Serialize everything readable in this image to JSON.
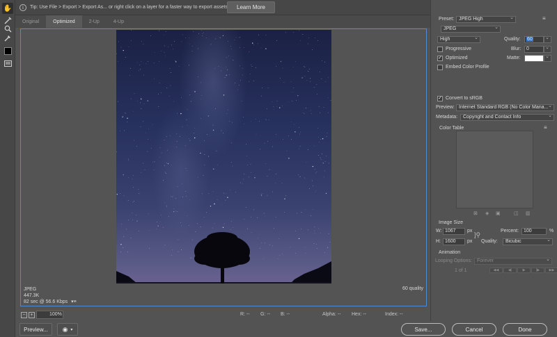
{
  "tip": {
    "icon": "info-circle-icon",
    "text": "Tip: Use File > Export > Export As...  or right click on a layer for a faster way to export assets",
    "learn_more": "Learn More"
  },
  "tabs": [
    {
      "label": "Original",
      "active": false
    },
    {
      "label": "Optimized",
      "active": true
    },
    {
      "label": "2-Up",
      "active": false
    },
    {
      "label": "4-Up",
      "active": false
    }
  ],
  "preview_info": {
    "format": "JPEG",
    "size": "447.3K",
    "time": "82 sec @ 56.6 Kbps",
    "quality": "60 quality"
  },
  "status": {
    "zoom_out": "−",
    "zoom_in": "+",
    "zoom": "100%",
    "r": "R: --",
    "g": "G: --",
    "b": "B: --",
    "alpha": "Alpha: --",
    "hex": "Hex: --",
    "index": "Index: --"
  },
  "buttons": {
    "preview": "Preview...",
    "save": "Save...",
    "cancel": "Cancel",
    "done": "Done"
  },
  "settings": {
    "preset_label": "Preset:",
    "preset": "JPEG High",
    "format": "JPEG",
    "compression": "High",
    "quality_label": "Quality:",
    "quality": "60",
    "progressive": "Progressive",
    "blur_label": "Blur:",
    "blur": "0",
    "optimized": "Optimized",
    "matte_label": "Matte:",
    "embed_profile": "Embed Color Profile",
    "convert_srgb": "Convert to sRGB",
    "preview_label": "Preview:",
    "preview_value": "Internet Standard RGB (No Color Mana...",
    "metadata_label": "Metadata:",
    "metadata_value": "Copyright and Contact Info",
    "color_table": "Color Table",
    "image_size": "Image Size",
    "w_label": "W:",
    "w_value": "1067",
    "h_label": "H:",
    "h_value": "1600",
    "px": "px",
    "percent_label": "Percent:",
    "percent_value": "100",
    "percent_unit": "%",
    "resample_label": "Quality:",
    "resample_value": "Bicubic",
    "animation": "Animation",
    "looping_label": "Looping Options:",
    "looping_value": "Forever",
    "frame_counter": "1 of 1"
  },
  "checks": {
    "progressive": false,
    "optimized": true,
    "embed_profile": false,
    "convert_srgb": true
  },
  "colors": {
    "accent": "#4d8bd3",
    "matte": "#ffffff",
    "quality_highlight": "#3b73c4"
  }
}
